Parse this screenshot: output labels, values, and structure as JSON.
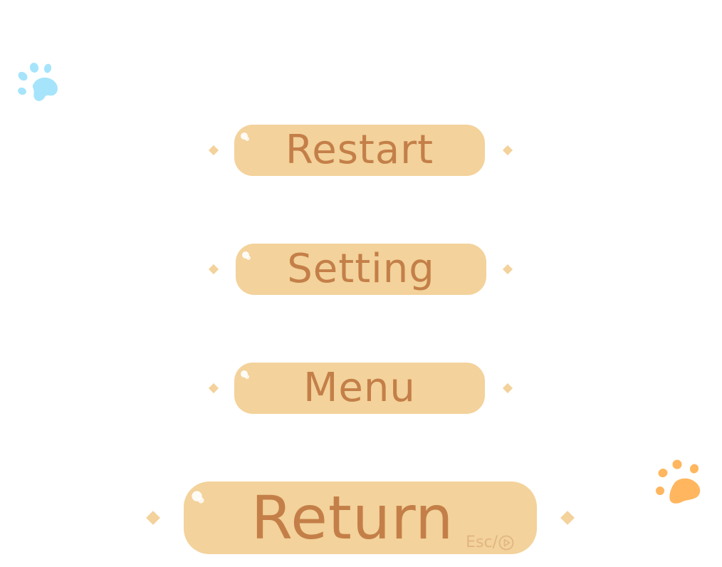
{
  "menu": {
    "restart_label": "Restart",
    "setting_label": "Setting",
    "menu_label": "Menu",
    "return_label": "Return",
    "return_hint": "Esc/"
  },
  "icons": {
    "paw_left": "paw-print-icon",
    "paw_right": "paw-print-icon",
    "hint_icon": "play-circle-icon",
    "shine": "sparkle-icon",
    "ornament": "diamond-icon"
  },
  "colors": {
    "button_fill": "#f3d29b",
    "button_text": "#c47f48",
    "hint_text": "#e2b580",
    "paw_blue": "#a6e4fb",
    "paw_orange": "#ffb65f",
    "background": "#ffffff"
  }
}
